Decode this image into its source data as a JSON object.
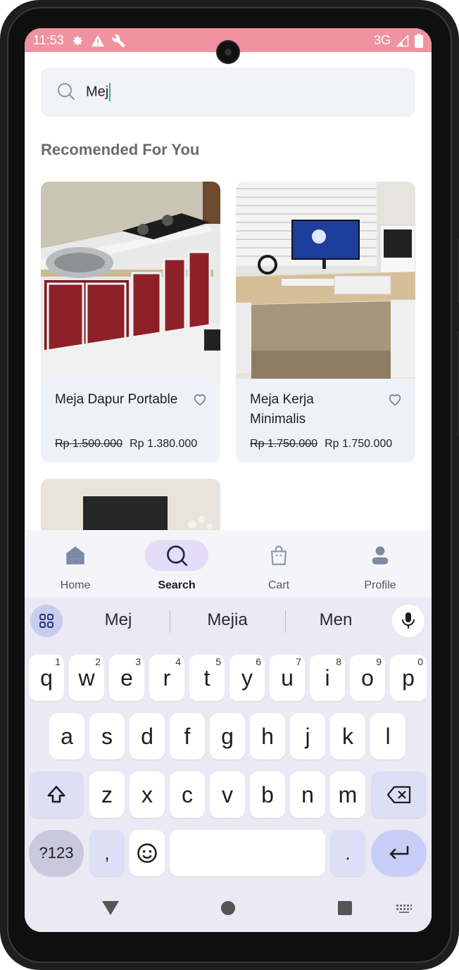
{
  "status_bar": {
    "time": "11:53",
    "network": "3G",
    "color": "#f0929f"
  },
  "search": {
    "value": "Mej",
    "icon": "search-icon"
  },
  "section": {
    "title": "Recomended For You"
  },
  "products": [
    {
      "name": "Meja Dapur Portable",
      "old_price": "Rp 1.500.000",
      "price": "Rp 1.380.000",
      "icon": "heart-icon"
    },
    {
      "name": "Meja Kerja Minimalis",
      "old_price": "Rp 1.750.000",
      "price": "Rp 1.750.000",
      "icon": "heart-icon"
    }
  ],
  "bottom_nav": [
    {
      "label": "Home",
      "icon": "home-icon",
      "active": false
    },
    {
      "label": "Search",
      "icon": "search-icon",
      "active": true
    },
    {
      "label": "Cart",
      "icon": "shopping-bag-icon",
      "active": false
    },
    {
      "label": "Profile",
      "icon": "person-icon",
      "active": false
    }
  ],
  "keyboard": {
    "suggestions": [
      "Mej",
      "Mejia",
      "Men"
    ],
    "row1": [
      {
        "key": "q",
        "sup": "1"
      },
      {
        "key": "w",
        "sup": "2"
      },
      {
        "key": "e",
        "sup": "3"
      },
      {
        "key": "r",
        "sup": "4"
      },
      {
        "key": "t",
        "sup": "5"
      },
      {
        "key": "y",
        "sup": "6"
      },
      {
        "key": "u",
        "sup": "7"
      },
      {
        "key": "i",
        "sup": "8"
      },
      {
        "key": "o",
        "sup": "9"
      },
      {
        "key": "p",
        "sup": "0"
      }
    ],
    "row2": [
      "a",
      "s",
      "d",
      "f",
      "g",
      "h",
      "j",
      "k",
      "l"
    ],
    "row3": [
      "z",
      "x",
      "c",
      "v",
      "b",
      "n",
      "m"
    ],
    "symbols_label": "?123",
    "comma": ",",
    "period": "."
  }
}
